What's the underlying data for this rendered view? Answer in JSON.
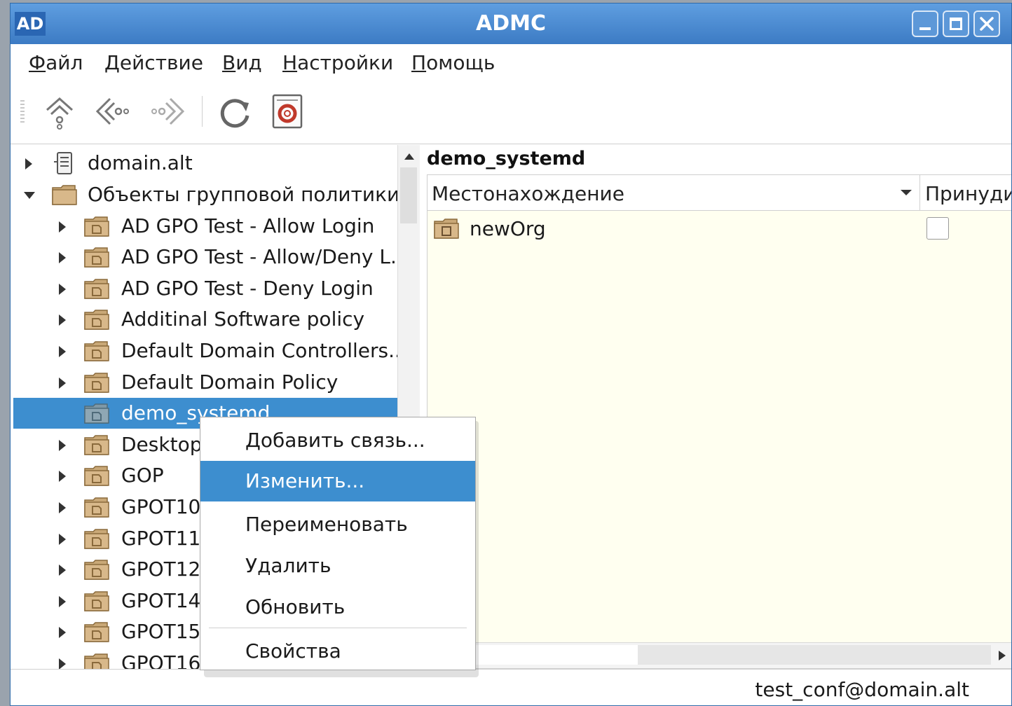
{
  "window": {
    "title": "ADMC",
    "logo": "AD"
  },
  "menubar": [
    {
      "u": "Ф",
      "rest": "айл"
    },
    {
      "u": "Д",
      "rest": "ействие"
    },
    {
      "u": "В",
      "rest": "ид"
    },
    {
      "u": "Н",
      "rest": "астройки"
    },
    {
      "u": "П",
      "rest": "омощь"
    }
  ],
  "toolbar": [
    "up-icon",
    "back-icon",
    "forward-icon",
    "refresh-icon",
    "manual-icon"
  ],
  "tree": {
    "root": "domain.alt",
    "gpo_container": "Объекты групповой политики",
    "items": [
      "AD GPO Test - Allow Login",
      "AD GPO Test - Allow/Deny L...",
      "AD GPO Test - Deny Login",
      "Additinal Software policy",
      "Default Domain Controllers...",
      "Default Domain Policy",
      "demo_systemd",
      "Desktop",
      "GOP",
      "GPOT10",
      "GPOT11",
      "GPOT12",
      "GPOT14",
      "GPOT15",
      "GPOT16"
    ],
    "selected": "demo_systemd"
  },
  "right_pane": {
    "title": "demo_systemd",
    "columns": [
      "Местонахождение",
      "Принуди"
    ],
    "rows": [
      {
        "location": "newOrg",
        "enforced": false
      }
    ]
  },
  "context_menu": {
    "items": [
      "Добавить связь...",
      "Изменить...",
      "Переименовать",
      "Удалить",
      "Обновить",
      "Свойства"
    ],
    "highlighted": "Изменить..."
  },
  "status": {
    "user": "test_conf@domain.alt"
  },
  "colors": {
    "accent": "#3d8ecf",
    "titlebar": "#4a8bd4",
    "grid_bg": "#fffff0"
  }
}
